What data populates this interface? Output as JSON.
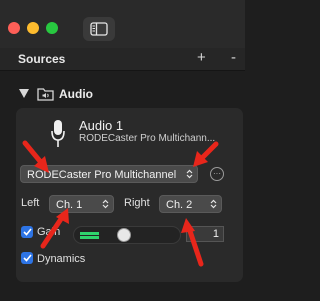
{
  "window": {
    "traffic_lights": [
      "close",
      "minimize",
      "zoom"
    ]
  },
  "sources": {
    "title": "Sources",
    "add_label": "+",
    "remove_label": "-"
  },
  "audio_group": {
    "label": "Audio"
  },
  "device": {
    "title": "Audio 1",
    "subtitle": "RODECaster Pro Multichann..."
  },
  "controls": {
    "device_select": "RODECaster Pro Multichannel",
    "more_label": "···",
    "left_label": "Left",
    "left_channel": "Ch. 1",
    "right_label": "Right",
    "right_channel": "Ch. 2",
    "gain_label": "Gain",
    "gain_value": "1",
    "gain_level": 0.45,
    "meter_level": 0.22,
    "dynamics_label": "Dynamics"
  },
  "colors": {
    "annotation_arrow": "#e8261b",
    "accent": "#2d74e5",
    "meter": "#2fd36d"
  }
}
